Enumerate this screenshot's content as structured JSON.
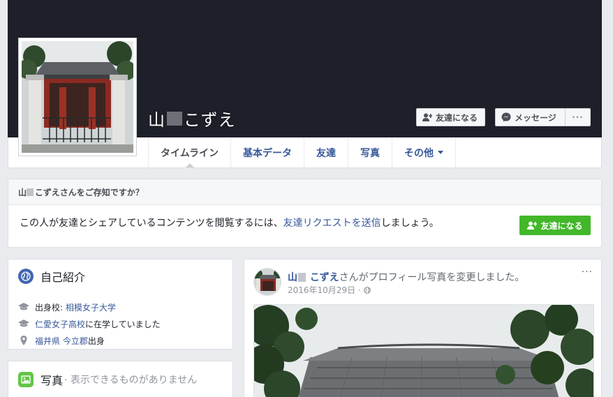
{
  "profile": {
    "name_prefix": "山",
    "name_suffix": "こずえ"
  },
  "actions": {
    "add_friend": "友達になる",
    "message": "メッセージ",
    "more": "···"
  },
  "tabs": [
    {
      "label": "タイムライン"
    },
    {
      "label": "基本データ"
    },
    {
      "label": "友達"
    },
    {
      "label": "写真"
    },
    {
      "label": "その他"
    }
  ],
  "know": {
    "heading_prefix": "山",
    "heading_suffix": "こずえさんをご存知ですか？",
    "body_before": "この人が友達とシェアしているコンテンツを閲覧するには、",
    "body_link": "友達リクエストを送信",
    "body_after": "しましょう。",
    "button": "友達になる"
  },
  "intro": {
    "title": "自己紹介",
    "school_prefix": "出身校: ",
    "school_link": "相模女子大学",
    "highschool_link": "仁愛女子高校",
    "highschool_suffix": "に在学していました",
    "home_pref": "福井県",
    "home_city": "今立郡",
    "home_suffix": "出身"
  },
  "photos": {
    "title": "写真",
    "subtitle": "· 表示できるものがありません"
  },
  "post": {
    "author_prefix": "山",
    "author_suffix": "こずえ",
    "action": "さんがプロフィール写真を変更しました。",
    "date": "2016年10月29日 ·",
    "menu": "···"
  },
  "colors": {
    "cover": "#1d2029",
    "link": "#365899",
    "green_button": "#42b72a",
    "background": "#e9ebee"
  }
}
